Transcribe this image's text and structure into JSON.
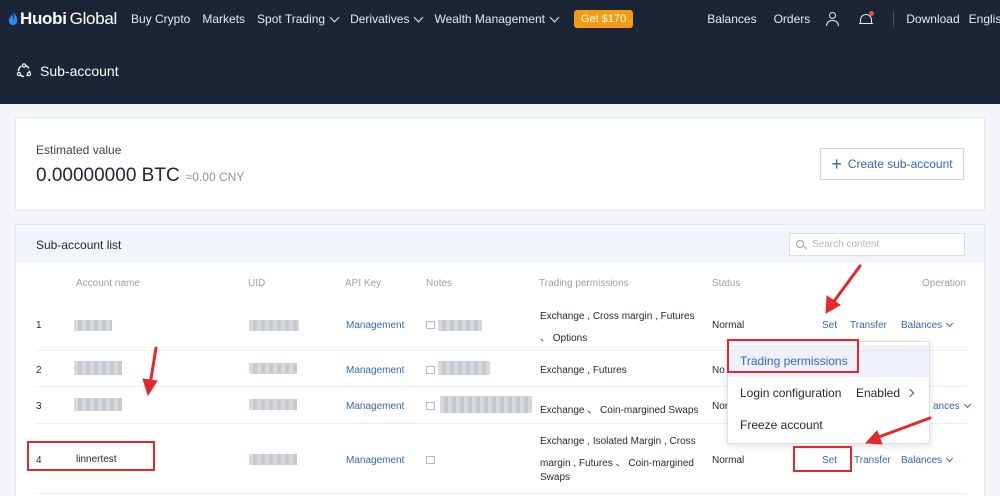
{
  "nav": {
    "logo_huobi": "Huobi",
    "logo_global": "Global",
    "items": [
      "Buy Crypto",
      "Markets",
      "Spot Trading",
      "Derivatives",
      "Wealth Management"
    ],
    "promo": "Get $170",
    "balances": "Balances",
    "orders": "Orders",
    "download": "Download",
    "language": "English"
  },
  "page": {
    "title": "Sub-account"
  },
  "estimate": {
    "label": "Estimated value",
    "value": "0.00000000 BTC",
    "cny": "≈0.00 CNY",
    "create_button": "Create sub-account"
  },
  "list": {
    "title": "Sub-account list",
    "search_placeholder": "Search content",
    "headers": {
      "account": "Account name",
      "uid": "UID",
      "apikey": "API Key",
      "notes": "Notes",
      "perms": "Trading permissions",
      "status": "Status",
      "operation": "Operation"
    },
    "rows": [
      {
        "index": "1",
        "account": "",
        "api": "Management",
        "perms_line1": "Exchange , Cross margin , Futures",
        "perms_line2": "、 Options",
        "status": "Normal",
        "set": "Set",
        "transfer": "Transfer",
        "balances": "Balances"
      },
      {
        "index": "2",
        "account": "",
        "api": "Management",
        "perms_line1": "Exchange , Futures",
        "status": "No"
      },
      {
        "index": "3",
        "account": "",
        "api": "Management",
        "perms_line1": "Exchange 、 Coin-margined Swaps",
        "status": "Nor",
        "balances_partial": "ances"
      },
      {
        "index": "4",
        "account": "linnertest",
        "api": "Management",
        "perms_line1": "Exchange , Isolated Margin , Cross",
        "perms_line2": "margin , Futures 、 Coin-margined",
        "perms_line3": "Swaps",
        "status": "Normal",
        "set": "Set",
        "transfer": "Transfer",
        "balances": "Balances"
      }
    ]
  },
  "dropdown": {
    "items": [
      "Trading permissions",
      "Login configuration",
      "Freeze account"
    ],
    "login_value": "Enabled"
  },
  "colors": {
    "nav_bg": "#1c2538",
    "link": "#3466c7",
    "promo": "#f39c12",
    "annotation": "#e5282d"
  }
}
